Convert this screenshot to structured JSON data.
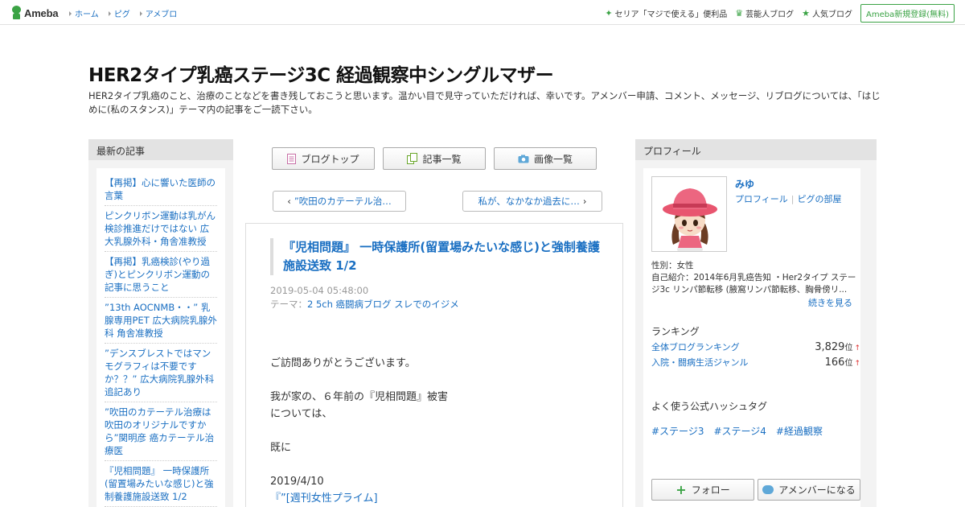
{
  "topbar": {
    "logo_text": "Ameba",
    "nav": [
      "ホーム",
      "ピグ",
      "アメブロ"
    ],
    "right_links": [
      {
        "label": "セリア「マジで使える」便利品",
        "icon": "sparkle-icon"
      },
      {
        "label": "芸能人ブログ",
        "icon": "crown-icon"
      },
      {
        "label": "人気ブログ",
        "icon": "star-icon"
      }
    ],
    "register_label": "Ameba新規登録(無料)"
  },
  "header": {
    "title": "HER2タイプ乳癌ステージ3C 経過観察中シングルマザー",
    "description": "HER2タイプ乳癌のこと、治療のことなどを書き残しておこうと思います。温かい目で見守っていただければ、幸いです。アメンバー申請、コメント、メッセージ、リブログについては、「はじめに(私のスタンス)」テーマ内の記事をご一読下さい。"
  },
  "left_sidebar": {
    "heading": "最新の記事",
    "items": [
      "【再掲】心に響いた医師の言葉",
      "ピンクリボン運動は乳がん検診推進だけではない 広大乳腺外科・角舎准教授",
      "【再掲】乳癌検診(やり過ぎ)とピンクリボン運動の記事に思うこと",
      "”13th AOCNMB・・” 乳腺専用PET 広大病院乳腺外科 角舎准教授",
      "”デンスブレストではマンモグラフィは不要ですか？？” 広大病院乳腺外科追記あり",
      "”吹田のカテーテル治療は吹田のオリジナルですから”関明彦 癌カテーテル治療医",
      "『児相問題』 一時保護所(留置場みたいな感じ)と強制養護施設送致 1/2"
    ]
  },
  "center": {
    "buttons": {
      "blog_top": "ブログトップ",
      "article_list": "記事一覧",
      "image_list": "画像一覧"
    },
    "pager": {
      "prev": "”吹田のカテーテル治…",
      "next": "私が、なかなか過去に…"
    },
    "entry": {
      "title": "『児相問題』 一時保護所(留置場みたいな感じ)と強制養護施設送致 1/2",
      "date": "2019-05-04 05:48:00",
      "theme_label": "テーマ：",
      "theme": "2 5ch 癌闘病ブログ スレでのイジメ",
      "body": [
        "ご訪問ありがとうございます。",
        "我が家の、６年前の『児相問題』被害",
        "については、",
        "既に",
        "2019/4/10",
        "『”[週刊女性プライム]"
      ]
    }
  },
  "right_sidebar": {
    "heading": "プロフィール",
    "name": "みゆ",
    "links": [
      "プロフィール",
      "ピグの部屋"
    ],
    "gender": "性別：女性",
    "intro": "自己紹介：2014年6月乳癌告知 ・Her2タイプ ステージ3c リンパ節転移 (腋窩リンパ節転移、胸骨傍リ...",
    "read_more": "続きを見る",
    "ranking_title": "ランキング",
    "rankings": [
      {
        "label": "全体ブログランキング",
        "value": "3,829",
        "unit": "位",
        "arrow": "↑"
      },
      {
        "label": "入院・闘病生活ジャンル",
        "value": "166",
        "unit": "位",
        "arrow": "↑"
      }
    ],
    "hashtag_title": "よく使う公式ハッシュタグ",
    "hashtags": [
      "#ステージ3",
      "#ステージ4",
      "#経過観察"
    ],
    "follow_label": "フォロー",
    "amember_label": "アメンバーになる"
  },
  "colors": {
    "brand_green": "#3ba345",
    "link_blue": "#1a6fc2",
    "sidebar_gray": "#f3f3f3",
    "rank_up_red": "#dd3333"
  }
}
